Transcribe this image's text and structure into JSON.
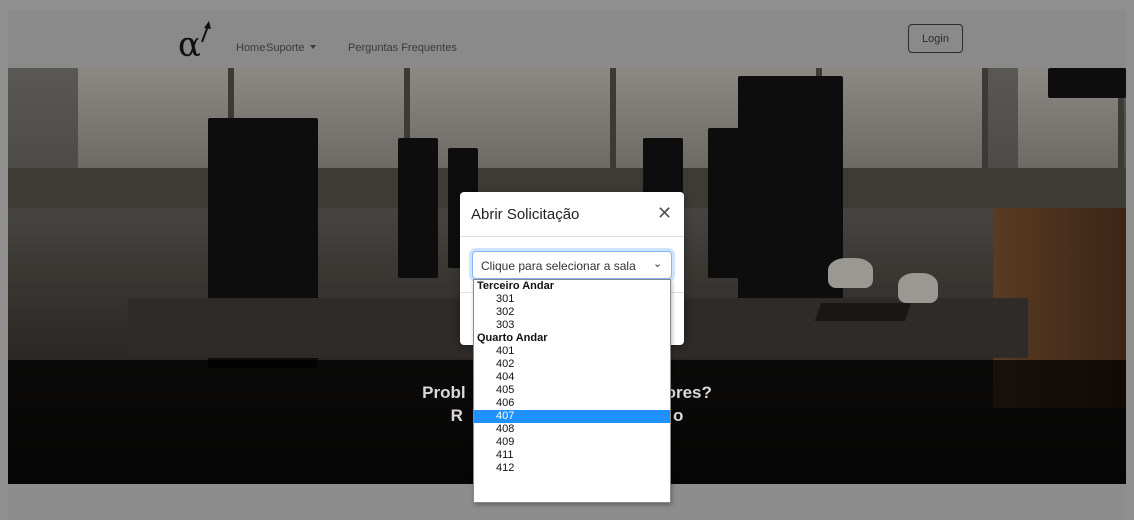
{
  "navbar": {
    "logo_icon": "alpha-arrow-logo",
    "links": [
      {
        "label": "Home"
      },
      {
        "label": "Suporte",
        "has_dropdown": true
      },
      {
        "label": "Perguntas Frequentes"
      }
    ],
    "login_label": "Login"
  },
  "hero": {
    "title_visible": "Probl",
    "title_visible_end": "ores?",
    "subtitle_visible_start": "R",
    "subtitle_visible_end": "o"
  },
  "modal": {
    "title": "Abrir Solicitação",
    "close_glyph": "✕",
    "select_placeholder": "Clique para selecionar a sala",
    "chevron": "⌄"
  },
  "dropdown": {
    "groups": [
      {
        "label": "Terceiro Andar",
        "options": [
          "301",
          "302",
          "303"
        ]
      },
      {
        "label": "Quarto Andar",
        "options": [
          "401",
          "402",
          "404",
          "405",
          "406",
          "407",
          "408",
          "409",
          "411",
          "412"
        ]
      }
    ],
    "selected": "407"
  },
  "colors": {
    "highlight": "#1e90ff",
    "focus_border": "#86b7fe"
  }
}
